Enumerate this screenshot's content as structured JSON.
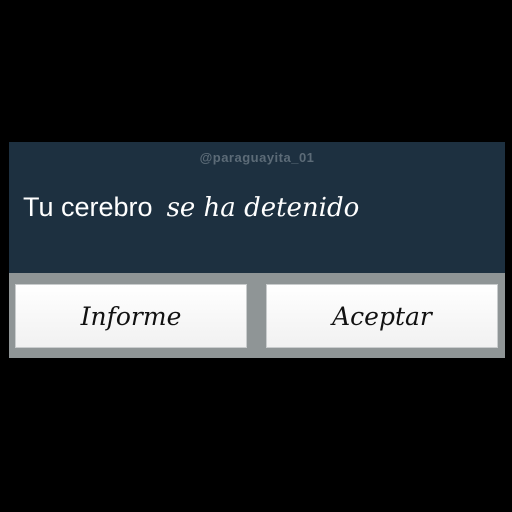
{
  "dialog": {
    "watermark": "@paraguayita_01",
    "app_name": "Tu cerebro",
    "message": "se ha detenido",
    "buttons": {
      "report_label": "Informe",
      "accept_label": "Aceptar"
    }
  },
  "colors": {
    "body_background": "#1d3040",
    "button_bar": "#8f9596",
    "button_face": "#ffffff"
  }
}
